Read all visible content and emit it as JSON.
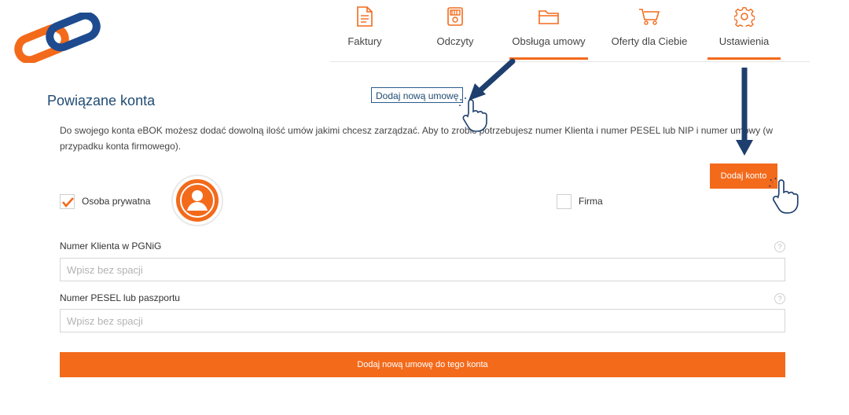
{
  "nav": {
    "items": [
      {
        "label": "Faktury",
        "icon": "invoice-icon"
      },
      {
        "label": "Odczyty",
        "icon": "meter-icon"
      },
      {
        "label": "Obsługa umowy",
        "icon": "folder-icon"
      },
      {
        "label": "Oferty dla Ciebie",
        "icon": "cart-icon"
      },
      {
        "label": "Ustawienia",
        "icon": "gear-icon",
        "active": true
      }
    ]
  },
  "page": {
    "title": "Powiązane konta",
    "description": "Do swojego konta eBOK możesz dodać dowolną ilość umów jakimi chcesz zarządzać. Aby to zrobić potrzebujesz numer Klienta i numer PESEL lub NIP i numer umowy (w przypadku konta firmowego)."
  },
  "buttons": {
    "new_contract": "Dodaj nową umowę",
    "add_account": "Dodaj konto",
    "submit": "Dodaj nową umowę do tego konta"
  },
  "account_type": {
    "private_label": "Osoba prywatna",
    "private_checked": true,
    "company_label": "Firma",
    "company_checked": false
  },
  "form": {
    "client_number": {
      "label": "Numer Klienta w PGNiG",
      "placeholder": "Wpisz bez spacji",
      "value": ""
    },
    "pesel": {
      "label": "Numer PESEL lub paszportu",
      "placeholder": "Wpisz bez spacji",
      "value": ""
    },
    "help": "?"
  },
  "colors": {
    "accent": "#f36a1b",
    "heading": "#1f4b73",
    "logo_blue": "#1e4b8f"
  }
}
